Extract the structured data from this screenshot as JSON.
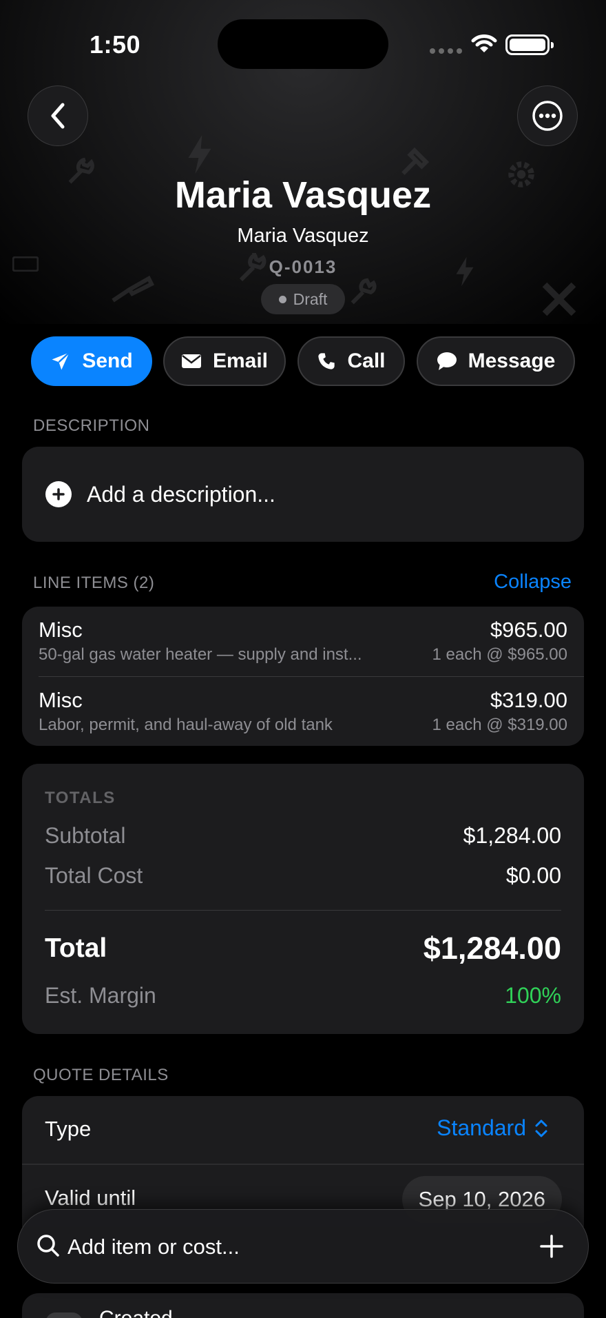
{
  "status_bar": {
    "time": "1:50"
  },
  "header": {
    "title": "Maria Vasquez",
    "subtitle": "Maria Vasquez",
    "quote_number": "Q-0013",
    "status": "Draft"
  },
  "actions": [
    {
      "label": "Send",
      "icon": "paperplane-icon"
    },
    {
      "label": "Email",
      "icon": "envelope-icon"
    },
    {
      "label": "Call",
      "icon": "phone-icon"
    },
    {
      "label": "Message",
      "icon": "chat-bubble-icon"
    }
  ],
  "description": {
    "label": "DESCRIPTION",
    "placeholder": "Add a description..."
  },
  "line_items": {
    "label": "LINE ITEMS (2)",
    "collapse_label": "Collapse",
    "items": [
      {
        "name": "Misc",
        "description": "50-gal gas water heater — supply and inst...",
        "amount": "$965.00",
        "quantity": "1 each @ $965.00"
      },
      {
        "name": "Misc",
        "description": "Labor, permit, and haul-away of old tank",
        "amount": "$319.00",
        "quantity": "1 each @ $319.00"
      }
    ]
  },
  "totals": {
    "heading": "TOTALS",
    "subtotal_label": "Subtotal",
    "subtotal_value": "$1,284.00",
    "cost_label": "Total Cost",
    "cost_value": "$0.00",
    "total_label": "Total",
    "total_value": "$1,284.00",
    "margin_label": "Est. Margin",
    "margin_value": "100%",
    "margin_color": "#30d158"
  },
  "quote_details": {
    "label": "QUOTE DETAILS",
    "type_label": "Type",
    "type_value": "Standard",
    "valid_label": "Valid until",
    "valid_value": "Sep 10, 2026"
  },
  "below_fold": {
    "toggle_label": "Created"
  },
  "search": {
    "placeholder": "Add item or cost..."
  },
  "colors": {
    "accent": "#0a84ff",
    "background": "#000000",
    "card": "#1c1c1e"
  }
}
